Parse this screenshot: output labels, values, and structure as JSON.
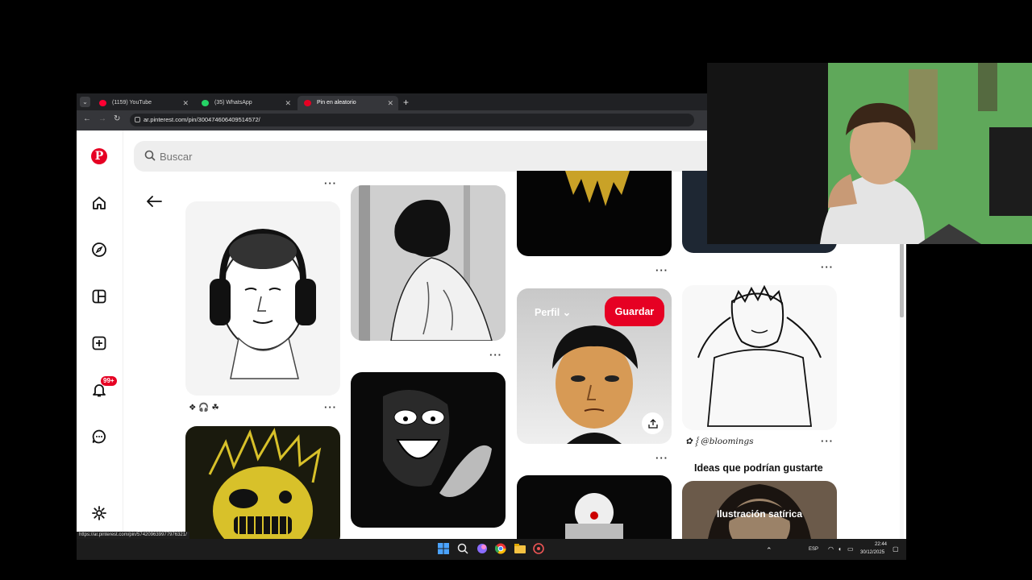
{
  "browser": {
    "tabs": [
      {
        "label": "(1159) YouTube",
        "color": "#ff0033"
      },
      {
        "label": "(35) WhatsApp",
        "color": "#25d366"
      },
      {
        "label": "Pin en aleatorio",
        "color": "#e60023"
      }
    ],
    "url": "ar.pinterest.com/pin/300474606409514572/",
    "status_url": "https://ar.pinterest.com/pin/574209639977976321/"
  },
  "search": {
    "placeholder": "Buscar"
  },
  "pins": {
    "pin1_caption": "❖ 🎧 ☘",
    "hover_profile": "Perfil",
    "hover_chevron": "⌄",
    "save_label": "Guardar",
    "pin4_caption": "✿ ⸾ @bloomings",
    "ideas_title": "Ideas que podrían gustarte",
    "idea_label": "Ilustración satírica",
    "more": "···"
  },
  "taskbar": {
    "lang": "ESP",
    "time": "22:44",
    "date": "30/12/2025"
  },
  "colors": {
    "accent": "#e60023"
  },
  "icons": [
    "pinterest-logo",
    "home-icon",
    "explore-icon",
    "boards-icon",
    "create-icon",
    "bell-icon",
    "messages-icon",
    "settings-icon",
    "search-icon",
    "back-arrow-icon",
    "share-icon"
  ]
}
